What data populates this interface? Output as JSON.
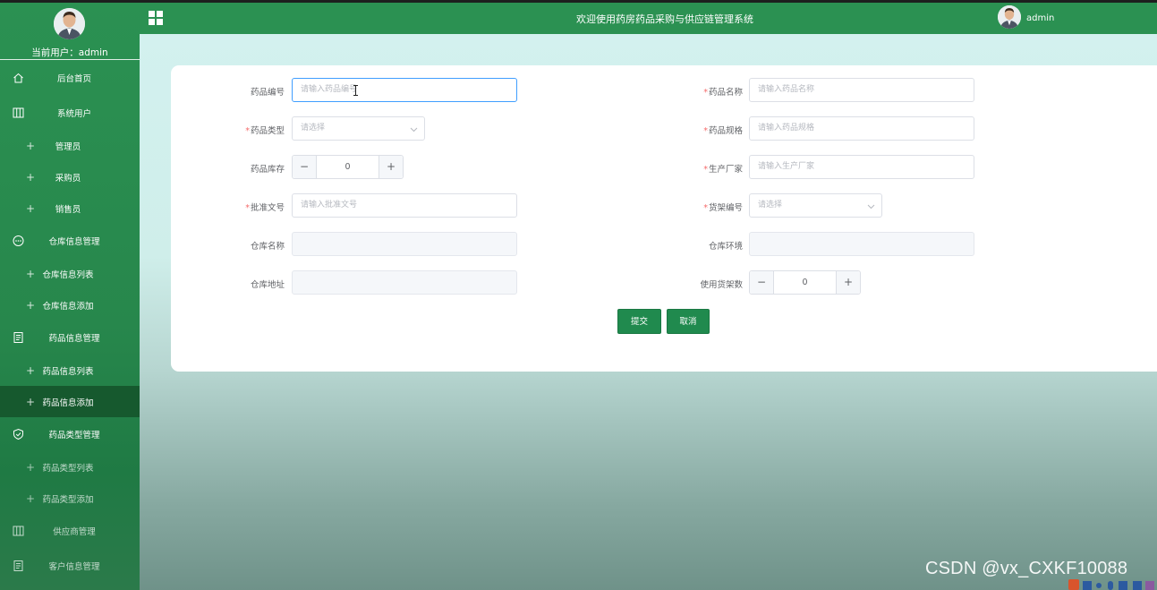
{
  "header": {
    "app_title": "欢迎使用药房药品采购与供应链管理系统",
    "username": "admin"
  },
  "sidebar": {
    "current_user_label": "当前用户：",
    "current_user": "admin",
    "items": [
      {
        "label": "后台首页",
        "icon": "home-icon",
        "type": "top"
      },
      {
        "label": "系统用户",
        "icon": "columns-icon",
        "type": "top"
      },
      {
        "label": "管理员",
        "type": "sub"
      },
      {
        "label": "采购员",
        "type": "sub"
      },
      {
        "label": "销售员",
        "type": "sub"
      },
      {
        "label": "仓库信息管理",
        "icon": "chat-dots-icon",
        "type": "top"
      },
      {
        "label": "仓库信息列表",
        "type": "sub"
      },
      {
        "label": "仓库信息添加",
        "type": "sub"
      },
      {
        "label": "药品信息管理",
        "icon": "document-icon",
        "type": "top"
      },
      {
        "label": "药品信息列表",
        "type": "sub"
      },
      {
        "label": "药品信息添加",
        "type": "sub",
        "active": true
      },
      {
        "label": "药品类型管理",
        "icon": "shield-check-icon",
        "type": "top"
      },
      {
        "label": "药品类型列表",
        "type": "sub"
      },
      {
        "label": "药品类型添加",
        "type": "sub"
      },
      {
        "label": "供应商管理",
        "icon": "columns-icon",
        "type": "top"
      },
      {
        "label": "客户信息管理",
        "icon": "document-icon",
        "type": "top"
      }
    ]
  },
  "form": {
    "drug_code": {
      "label": "药品编号",
      "placeholder": "请输入药品编号",
      "required": false
    },
    "drug_name": {
      "label": "药品名称",
      "placeholder": "请输入药品名称",
      "required": true
    },
    "drug_type": {
      "label": "药品类型",
      "placeholder": "请选择",
      "required": true
    },
    "drug_spec": {
      "label": "药品规格",
      "placeholder": "请输入药品规格",
      "required": true
    },
    "drug_stock": {
      "label": "药品库存",
      "value": "0",
      "required": false
    },
    "manufacturer": {
      "label": "生产厂家",
      "placeholder": "请输入生产厂家",
      "required": true
    },
    "approval_no": {
      "label": "批准文号",
      "placeholder": "请输入批准文号",
      "required": true
    },
    "shelf_no": {
      "label": "货架编号",
      "placeholder": "请选择",
      "required": true
    },
    "warehouse_name": {
      "label": "仓库名称",
      "placeholder": "",
      "required": false
    },
    "warehouse_env": {
      "label": "仓库环境",
      "placeholder": "",
      "required": false
    },
    "warehouse_addr": {
      "label": "仓库地址",
      "placeholder": "",
      "required": false
    },
    "shelves_used": {
      "label": "使用货架数",
      "value": "0",
      "required": false
    },
    "required_mark": "*",
    "submit_label": "提交",
    "cancel_label": "取消",
    "stepper_minus": "−",
    "stepper_plus": "+"
  },
  "watermark": "CSDN @vx_CXKF10088",
  "colors": {
    "sidebar": "#2b9152",
    "header": "#2b9152",
    "active_item": "#16592e",
    "button": "#208a4e",
    "focus_border": "#409eff",
    "required": "#f56c6c"
  }
}
